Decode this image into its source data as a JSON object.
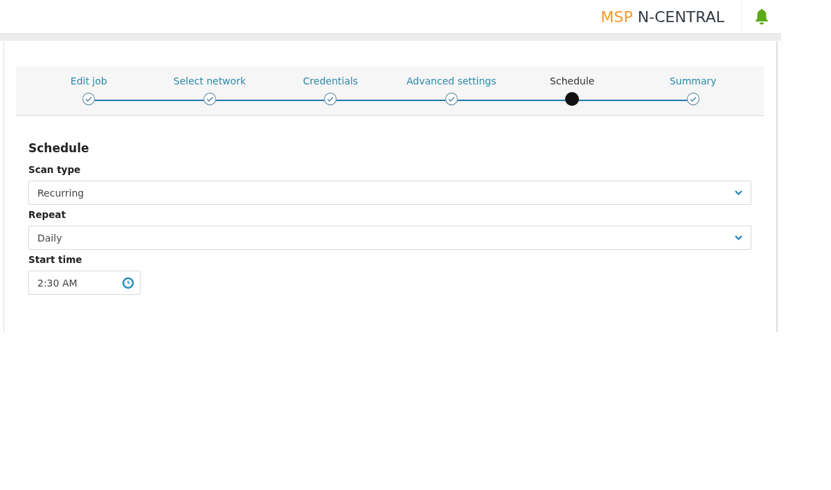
{
  "header": {
    "logo_prefix": "MSP",
    "logo_name": "N-CENTRAL"
  },
  "steps": [
    {
      "label": "Edit job",
      "selected": false
    },
    {
      "label": "Select network",
      "selected": false
    },
    {
      "label": "Credentials",
      "selected": false
    },
    {
      "label": "Advanced settings",
      "selected": false
    },
    {
      "label": "Schedule",
      "selected": true
    },
    {
      "label": "Summary",
      "selected": false
    }
  ],
  "section_title": "Schedule",
  "fields": [
    {
      "kind": "select",
      "label": "Scan type",
      "value": "Recurring"
    },
    {
      "kind": "select",
      "label": "Repeat",
      "value": "Daily"
    },
    {
      "kind": "time",
      "label": "Start time",
      "value": "2:30 AM"
    }
  ]
}
